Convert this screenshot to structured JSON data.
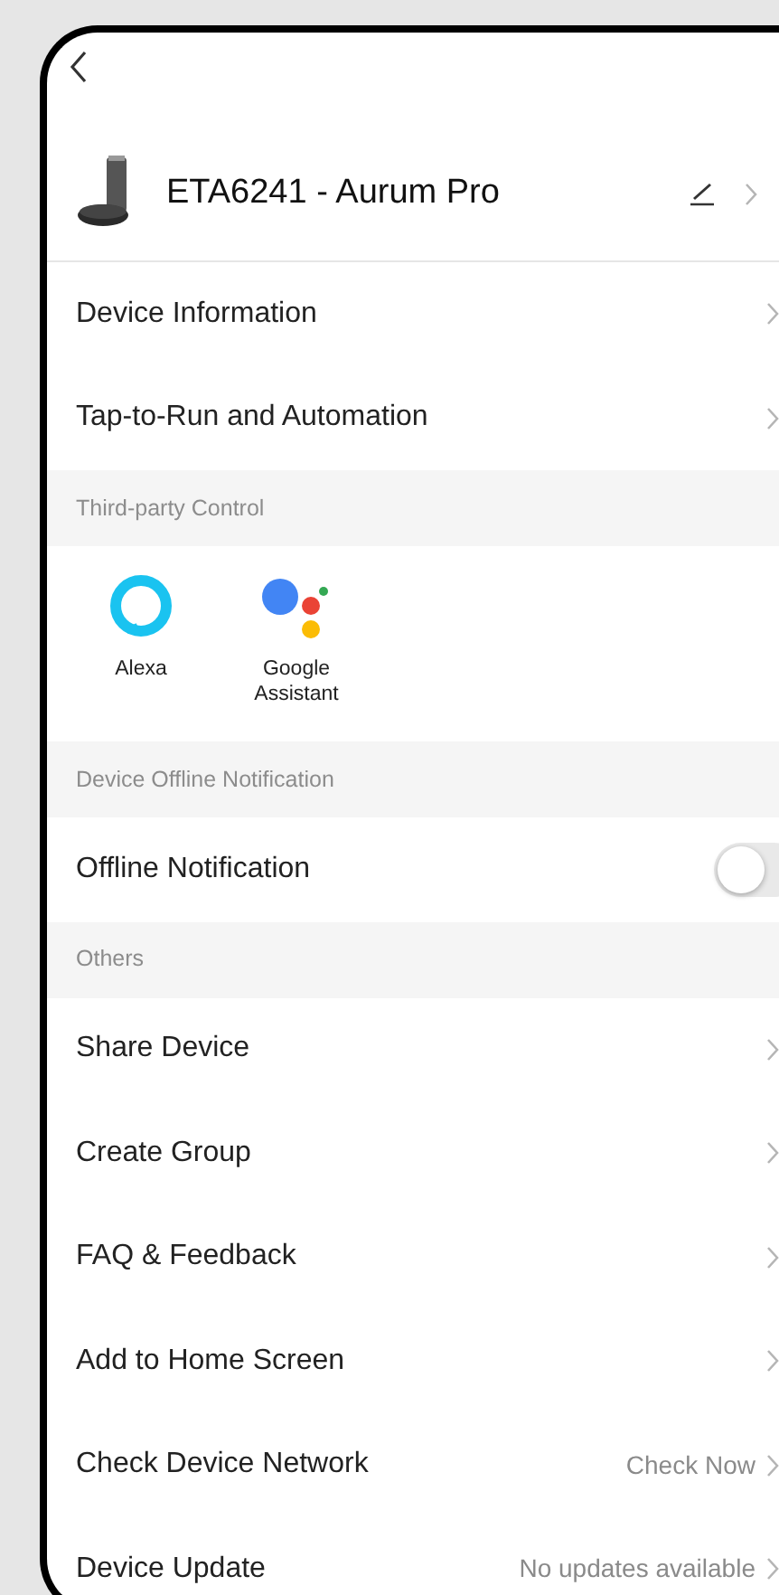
{
  "header": {
    "title": "ETA6241 - Aurum Pro"
  },
  "sections": [
    {
      "kind": "list",
      "items": [
        {
          "kind": "link",
          "label": "Device Information"
        },
        {
          "kind": "link",
          "label": "Tap-to-Run and Automation"
        }
      ]
    },
    {
      "kind": "services",
      "title": "Third-party Control",
      "services": [
        {
          "kind": "alexa",
          "name": "Alexa"
        },
        {
          "kind": "google",
          "name": "Google Assistant"
        }
      ]
    },
    {
      "kind": "list",
      "title": "Device Offline Notification",
      "items": [
        {
          "kind": "toggle",
          "label": "Offline Notification",
          "on": false
        }
      ]
    },
    {
      "kind": "list",
      "title": "Others",
      "items": [
        {
          "kind": "link",
          "label": "Share Device"
        },
        {
          "kind": "link",
          "label": "Create Group"
        },
        {
          "kind": "link",
          "label": "FAQ & Feedback"
        },
        {
          "kind": "link",
          "label": "Add to Home Screen"
        },
        {
          "kind": "link",
          "label": "Check Device Network",
          "value": "Check Now"
        },
        {
          "kind": "link",
          "label": "Device Update",
          "value": "No updates available"
        }
      ]
    }
  ]
}
